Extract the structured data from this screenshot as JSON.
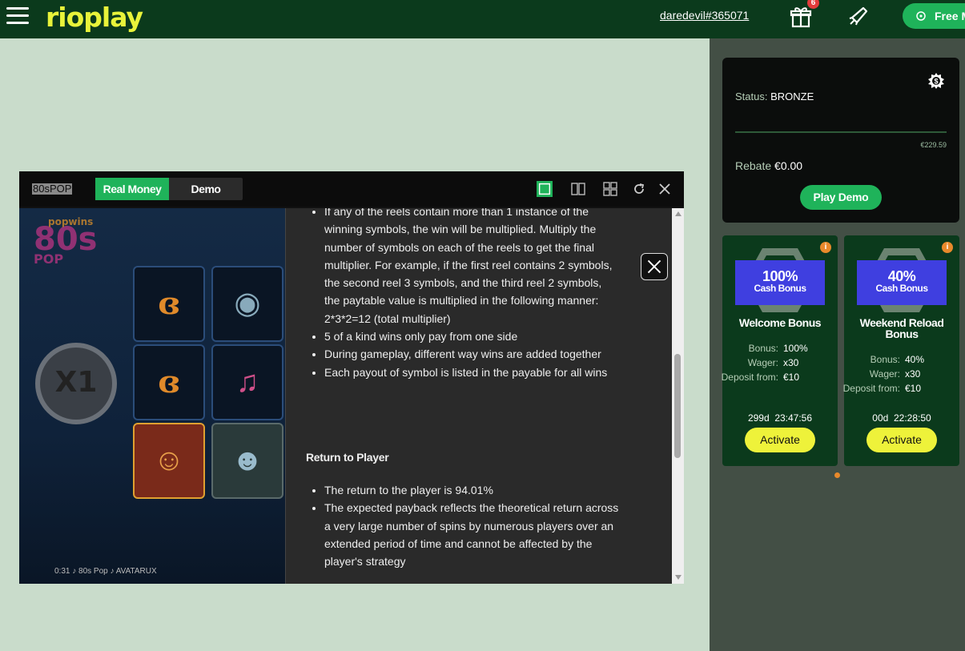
{
  "header": {
    "logo": "rioplay",
    "username": "daredevil#365071",
    "gift_badge": "6",
    "free_button": "Free M"
  },
  "status": {
    "label": "Status:",
    "level": "BRONZE",
    "progress_fraction": 0.0,
    "target": "€229.59",
    "rebate_label": "Rebate",
    "rebate_value": "€0.00",
    "play_demo": "Play Demo"
  },
  "bonuses": [
    {
      "percent": "100%",
      "badge_label": "Cash Bonus",
      "title": "Welcome Bonus",
      "bonus_label": "Bonus:",
      "bonus_value": "100%",
      "wager_label": "Wager:",
      "wager_value": "x30",
      "deposit_label": "Deposit from:",
      "deposit_value": "€10",
      "timer": "299d  23:47:56",
      "button": "Activate"
    },
    {
      "percent": "40%",
      "badge_label": "Cash Bonus",
      "title": "Weekend Reload Bonus",
      "bonus_label": "Bonus:",
      "bonus_value": "40%",
      "wager_label": "Wager:",
      "wager_value": "x30",
      "deposit_label": "Deposit from:",
      "deposit_value": "€10",
      "timer": "00d  22:28:50",
      "button": "Activate"
    }
  ],
  "game": {
    "name": "80sPOP",
    "mode_real": "Real Money",
    "mode_demo": "Demo",
    "multiplier": "X1",
    "footer": "0:31  ♪ 80s Pop ♪   AVATARUX",
    "logo_top": "popwins",
    "logo_main": "80s",
    "logo_sub": "POP"
  },
  "paytable": {
    "list1": [
      "If any of the reels contain more than 1 instance of the winning symbols, the win will be multiplied. Multiply the number of symbols on each of the reels to get the final multiplier. For example, if the first reel contains 2 symbols, the second reel 3 symbols, and the third reel 2 symbols, the paytable value is multiplied in the following manner: 2*3*2=12 (total multiplier)",
      "5 of a kind wins only pay from one side",
      "During gameplay, different way wins are added together",
      "Each payout of symbol is listed in the payable for all wins"
    ],
    "heading": "Return to Player",
    "list2": [
      "The return to the player is 94.01%",
      "The expected payback reflects the theoretical return across a very large number of spins by numerous players over an extended period of time and cannot be affected by the player's strategy"
    ]
  }
}
